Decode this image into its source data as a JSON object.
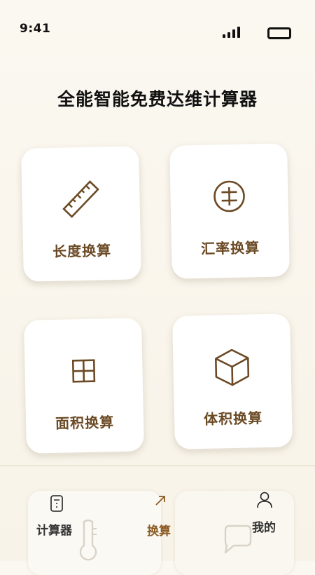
{
  "status_bar": {
    "time": "9:41"
  },
  "app": {
    "title": "全能智能免费达维计算器"
  },
  "cards": [
    {
      "id": "length",
      "label": "长度换算",
      "icon": "ruler-icon"
    },
    {
      "id": "currency",
      "label": "汇率换算",
      "icon": "currency-icon"
    },
    {
      "id": "area",
      "label": "面积换算",
      "icon": "grid-icon"
    },
    {
      "id": "volume",
      "label": "体积换算",
      "icon": "cube-icon"
    }
  ],
  "nav": {
    "items": [
      {
        "label": "计算器",
        "icon": "calculator-icon",
        "active": false
      },
      {
        "label": "换算",
        "icon": "arrow-icon",
        "active": true
      },
      {
        "label": "我的",
        "icon": "person-icon",
        "active": false
      }
    ]
  },
  "colors": {
    "accent": "#6b4a25",
    "active_tab": "#8a5a22",
    "background": "#faf6ee"
  }
}
